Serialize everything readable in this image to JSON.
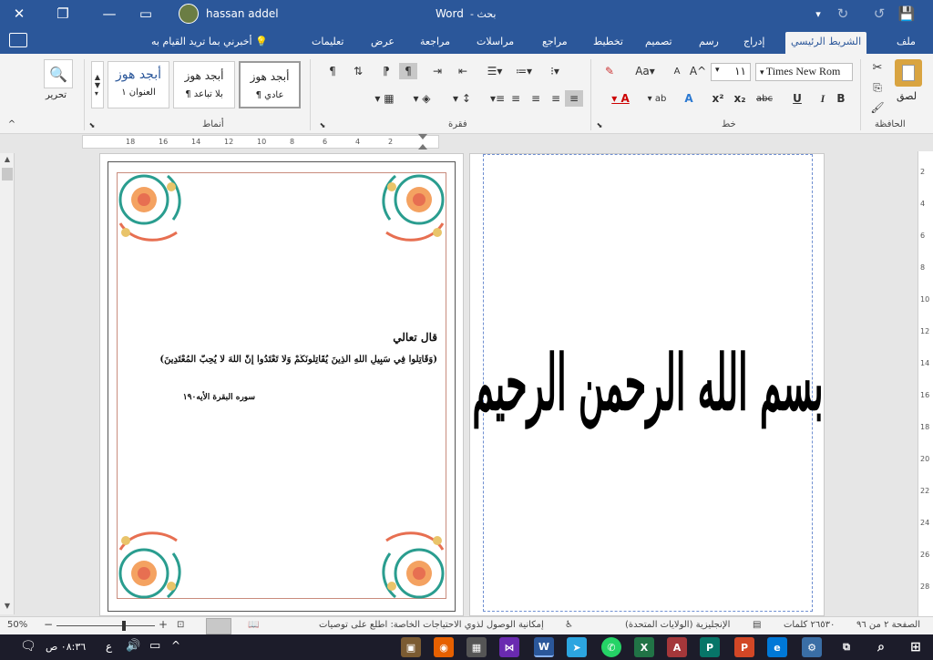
{
  "window": {
    "app_title": "Word",
    "search": "بحث -",
    "user": "hassan addel"
  },
  "tabs": [
    "ملف",
    "الشريط الرئيسي",
    "إدراج",
    "رسم",
    "تصميم",
    "تخطيط",
    "مراجع",
    "مراسلات",
    "مراجعة",
    "عرض",
    "تعليمات",
    "أخبرني بما تريد القيام به"
  ],
  "ribbon": {
    "clipboard": {
      "paste": "لصق",
      "label": "الحافظة"
    },
    "font": {
      "name": "Times New Rom",
      "size": "١١",
      "label": "خط",
      "grow": "A^",
      "shrink": "A",
      "case": "Aa",
      "bold": "B",
      "italic": "I",
      "underline": "U",
      "strike": "abc",
      "sub": "x₂",
      "sup": "x²"
    },
    "paragraph": {
      "label": "فقرة"
    },
    "styles": {
      "label": "أنماط",
      "items": [
        {
          "sample": "أبجد هوز",
          "name": "¶ عادي"
        },
        {
          "sample": "أبجد هوز",
          "name": "¶ بلا تباعد"
        },
        {
          "sample": "أبجد هوز",
          "name": "العنوان ١"
        }
      ]
    },
    "editing": {
      "label": "تحرير"
    }
  },
  "ruler": {
    "ticks": [
      "2",
      "4",
      "6",
      "8",
      "10",
      "12",
      "14",
      "16",
      "18"
    ]
  },
  "vruler": {
    "ticks": [
      "2",
      "4",
      "6",
      "8",
      "10",
      "12",
      "14",
      "16",
      "18",
      "20",
      "22",
      "24",
      "26",
      "28"
    ]
  },
  "doc": {
    "heading": "قال تعالي",
    "verse": "(وَقَاتِلُوا فِي سَبِيلِ اللَّهِ الَّذِينَ يُقَاتِلُونَكُمْ وَلَا تَعْتَدُوا إِنَّ اللَّهَ لَا يُحِبُّ الْمُعْتَدِينَ)",
    "ref": "سوره البقرة الأيه١٩٠",
    "calligraphy": "بسم الله الرحمن الرحيم"
  },
  "status": {
    "page": "الصفحة ٢ من ٩٦",
    "words": "٢٦٥٣٠ كلمات",
    "lang": "الإنجليزية (الولايات المتحدة)",
    "access": "إمكانية الوصول لذوي الاحتياجات الخاصة: اطلع على توصيات",
    "zoom": "50%"
  },
  "taskbar": {
    "time": "٠٨:٣٦ ص",
    "lang": "ع"
  },
  "colors": {
    "accent": "#2b579a",
    "page_border": "#c98c7d",
    "word_blue": "#2b579a",
    "taskbar": "#1c1c2a"
  }
}
